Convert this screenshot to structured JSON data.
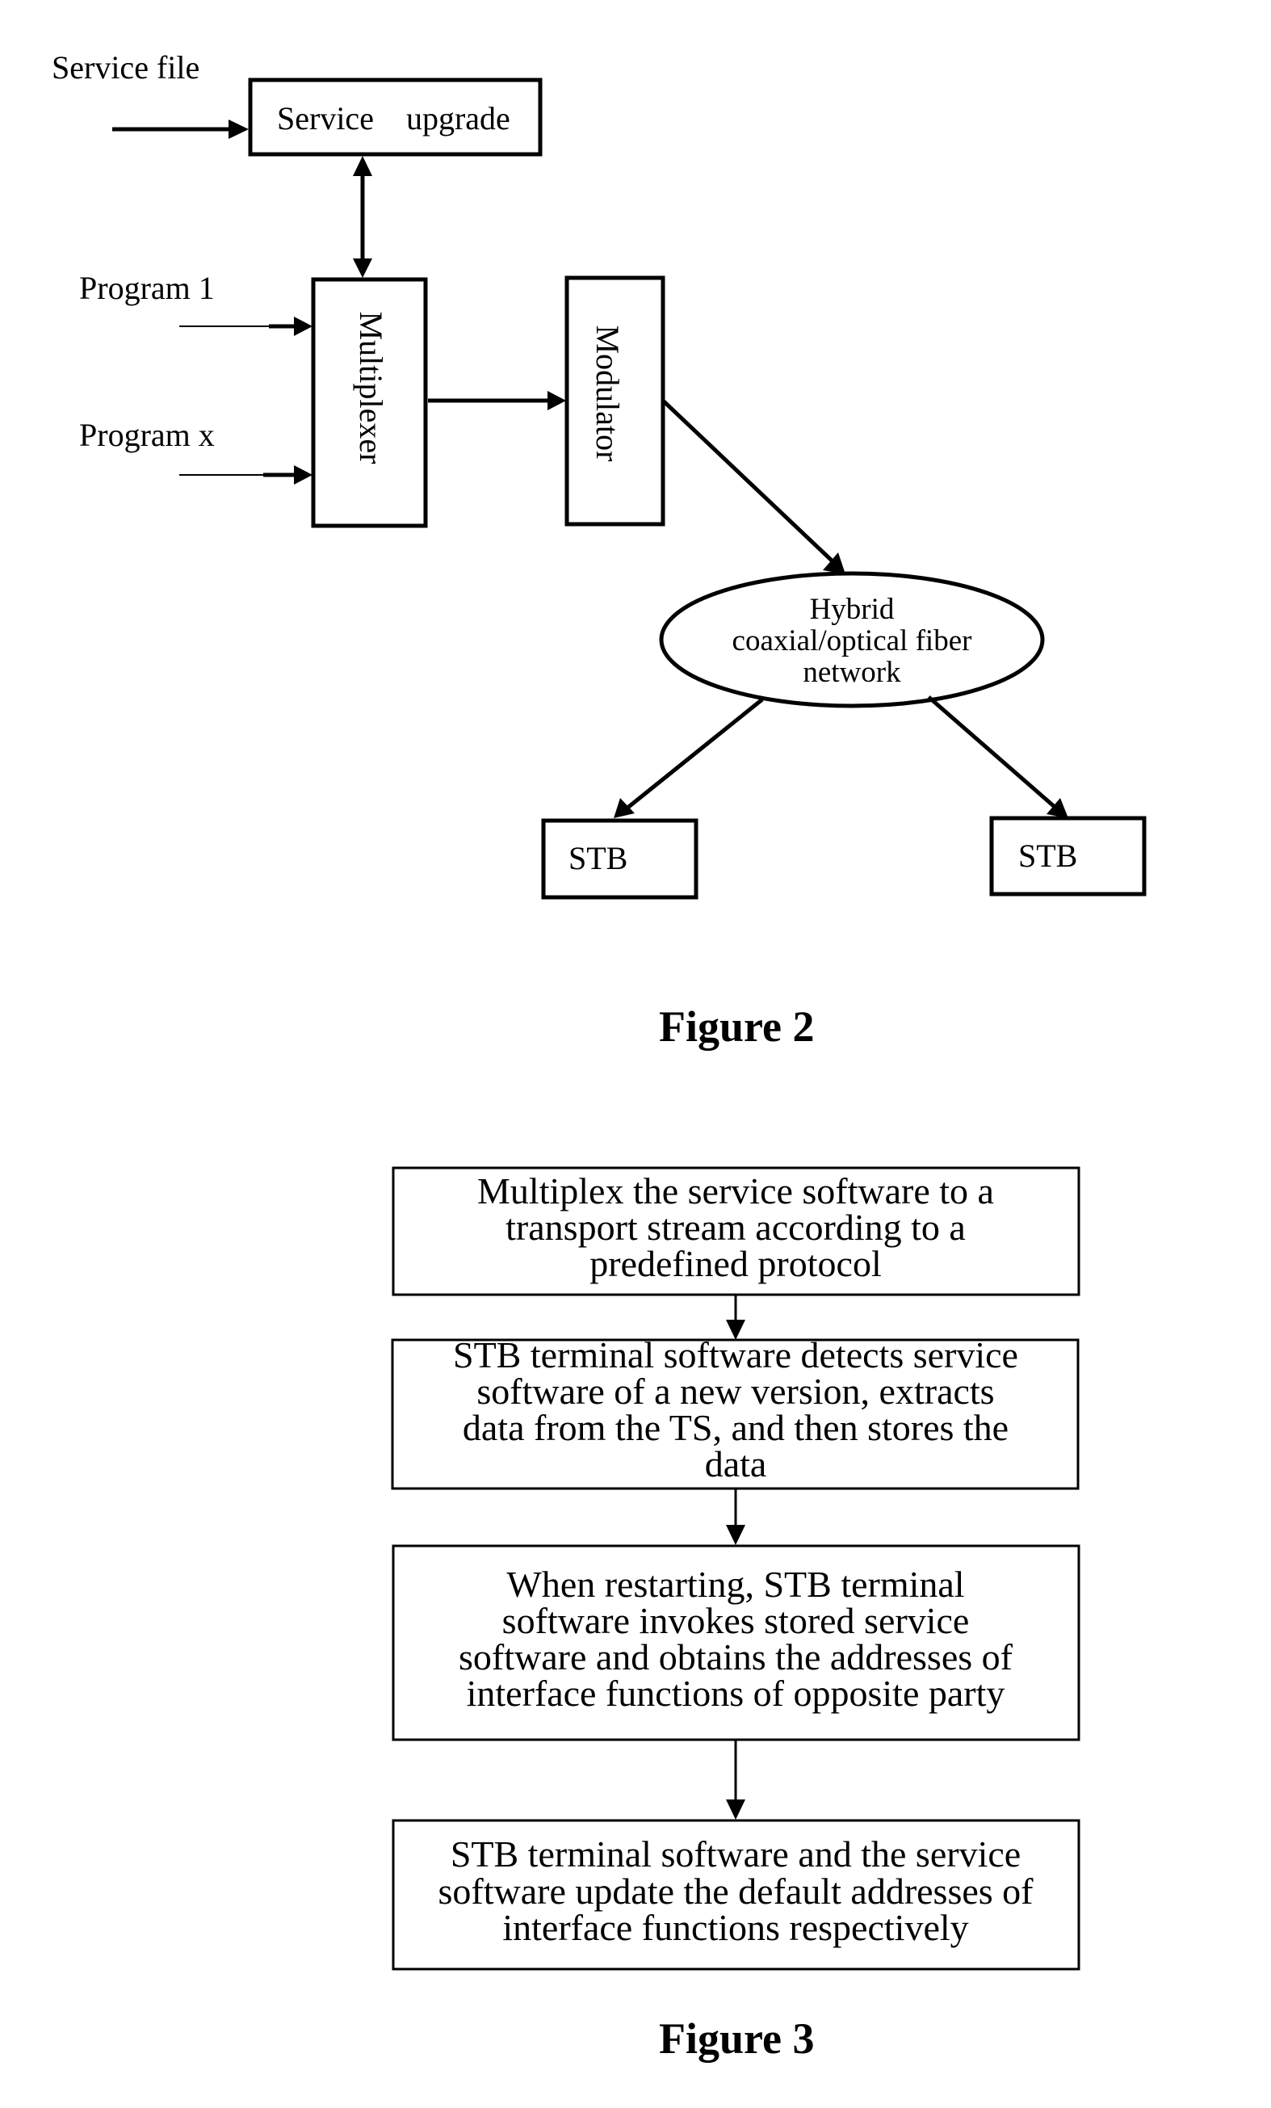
{
  "figure2": {
    "caption": "Figure 2",
    "inputs": {
      "service_file": "Service file",
      "program_1": "Program 1",
      "program_x": "Program x"
    },
    "nodes": {
      "service_upgrade": "Service    upgrade",
      "multiplexer": "Multiplexer",
      "modulator": "Modulator",
      "network": [
        "Hybrid",
        "coaxial/optical fiber",
        "network"
      ],
      "stb_left": "STB",
      "stb_right": "STB"
    },
    "edges": [
      {
        "from": "Service file",
        "to": "Service upgrade",
        "type": "arrow"
      },
      {
        "from": "Service upgrade",
        "to": "Multiplexer",
        "type": "bidirectional"
      },
      {
        "from": "Program 1",
        "to": "Multiplexer",
        "type": "arrow"
      },
      {
        "from": "Program x",
        "to": "Multiplexer",
        "type": "arrow"
      },
      {
        "from": "Multiplexer",
        "to": "Modulator",
        "type": "arrow"
      },
      {
        "from": "Modulator",
        "to": "Hybrid coaxial/optical fiber network",
        "type": "arrow"
      },
      {
        "from": "Hybrid coaxial/optical fiber network",
        "to": "STB (left)",
        "type": "arrow"
      },
      {
        "from": "Hybrid coaxial/optical fiber network",
        "to": "STB (right)",
        "type": "arrow"
      }
    ]
  },
  "figure3": {
    "caption": "Figure 3",
    "steps": [
      {
        "lines": [
          "Multiplex the service software to a",
          "transport stream according to a",
          "predefined protocol"
        ]
      },
      {
        "lines": [
          "STB terminal software detects service",
          "software of a new version, extracts",
          "data from the TS, and then stores the",
          "data"
        ]
      },
      {
        "lines": [
          "When restarting, STB terminal",
          "software invokes stored service",
          "software and obtains the addresses of",
          "interface functions of opposite party"
        ]
      },
      {
        "lines": [
          "STB terminal software and the service",
          "software update the default addresses of",
          "interface functions respectively"
        ]
      }
    ]
  }
}
